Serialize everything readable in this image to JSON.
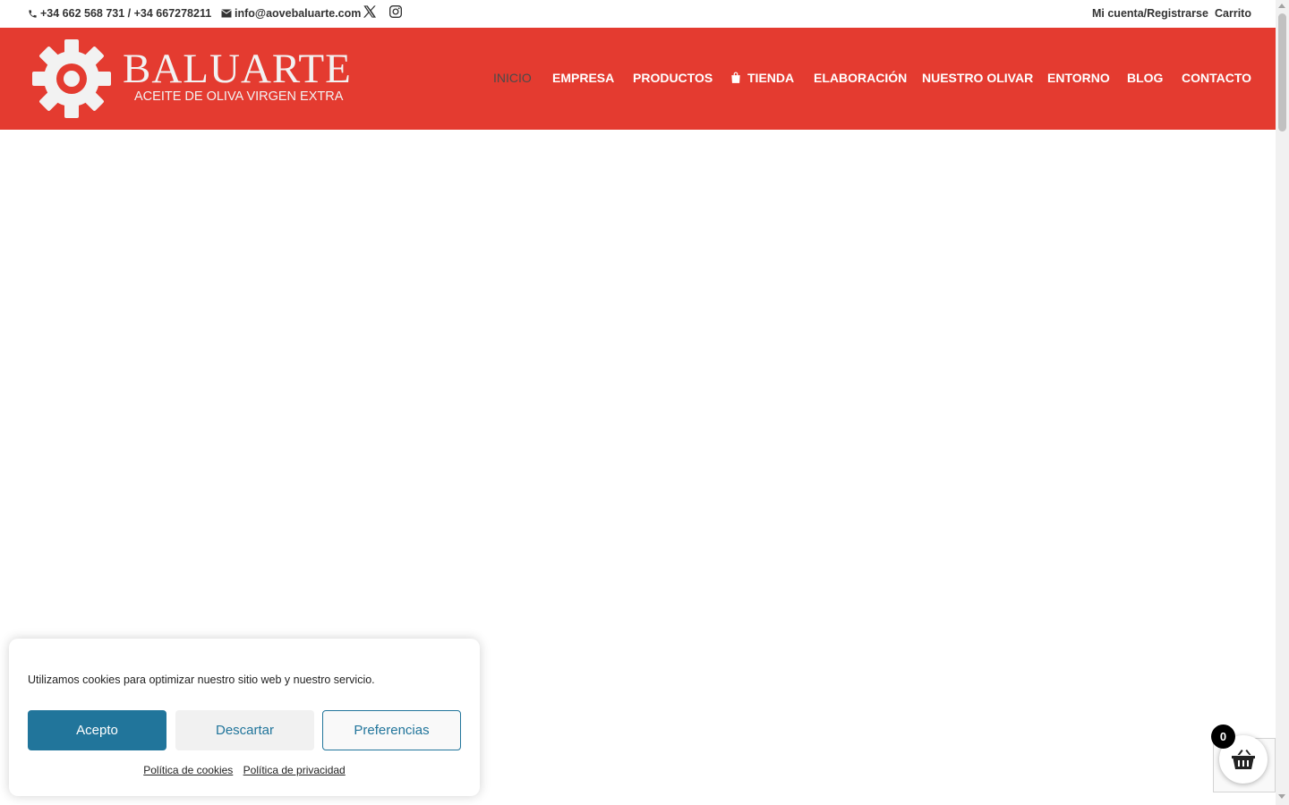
{
  "topbar": {
    "phone": "+34 662 568 731 / +34 667278211",
    "email": "info@aovebaluarte.com",
    "social": [
      "x-icon",
      "instagram-icon"
    ],
    "account": "Mi cuenta/Registrarse",
    "cart": "Carrito"
  },
  "header": {
    "background": "#e43b30",
    "logo": {
      "title": "BALUARTE",
      "subtitle": "ACEITE DE OLIVA VIRGEN EXTRA"
    },
    "nav": [
      {
        "label": "INICIO",
        "active": true
      },
      {
        "label": "EMPRESA"
      },
      {
        "label": "PRODUCTOS"
      },
      {
        "label": "TIENDA",
        "icon": "shopping-bag-icon"
      },
      {
        "label": "ELABORACIÓN"
      },
      {
        "label": "NUESTRO OLIVAR"
      },
      {
        "label": "ENTORNO"
      },
      {
        "label": "BLOG"
      },
      {
        "label": "CONTACTO"
      }
    ]
  },
  "cookie_banner": {
    "message": "Utilizamos cookies para optimizar nuestro sitio web y nuestro servicio.",
    "accept": "Acepto",
    "dismiss": "Descartar",
    "preferences": "Preferencias",
    "links": [
      "Política de cookies",
      "Política de privacidad"
    ],
    "accent": "#21759b"
  },
  "minicart": {
    "count": "0",
    "icon": "basket-icon"
  }
}
